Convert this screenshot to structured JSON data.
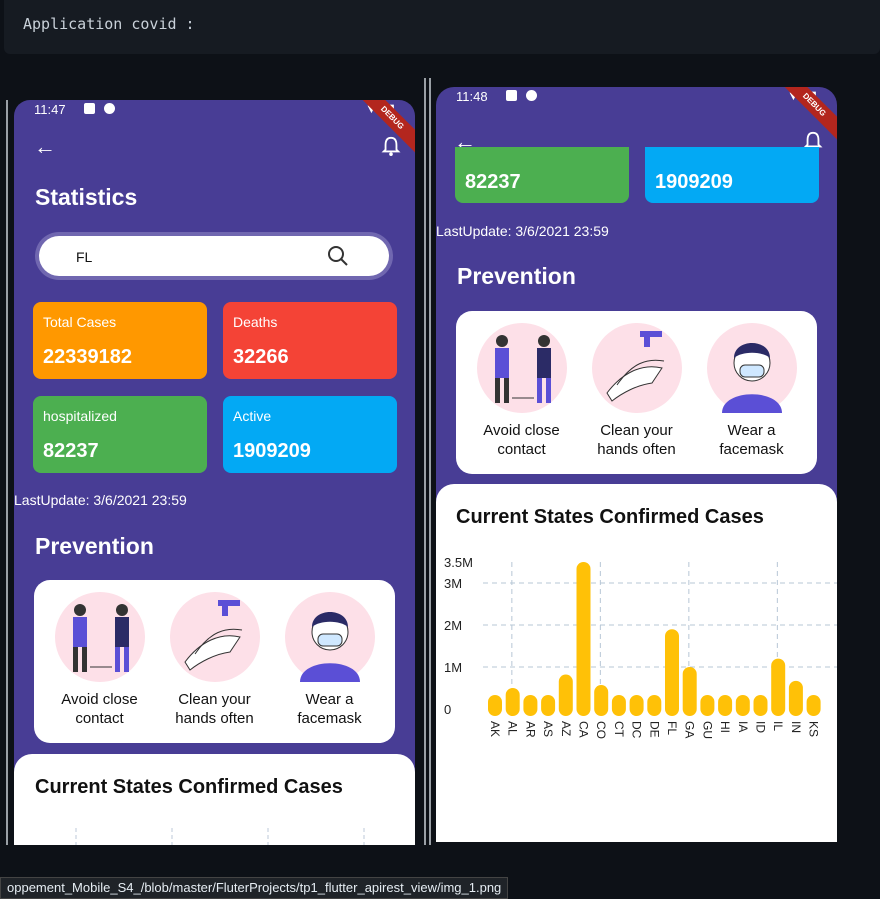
{
  "code_block": {
    "text": "Application covid :"
  },
  "phone1": {
    "time": "11:47",
    "debug": "DEBUG",
    "title": "Statistics",
    "search_value": "FL",
    "cards": [
      {
        "label": "Total Cases",
        "value": "22339182",
        "color": "#ff9800"
      },
      {
        "label": "Deaths",
        "value": "32266",
        "color": "#f44336"
      },
      {
        "label": "hospitalized",
        "value": "82237",
        "color": "#4caf50"
      },
      {
        "label": "Active",
        "value": "1909209",
        "color": "#03a9f4"
      }
    ],
    "last_update": "LastUpdate: 3/6/2021 23:59",
    "prevention_title": "Prevention",
    "prevention": [
      {
        "line1": "Avoid close",
        "line2": "contact",
        "icon": "avoid-contact-icon"
      },
      {
        "line1": "Clean your",
        "line2": "hands often",
        "icon": "wash-hands-icon"
      },
      {
        "line1": "Wear a",
        "line2": "facemask",
        "icon": "facemask-icon"
      }
    ],
    "chart_title": "Current States Confirmed Cases"
  },
  "phone2": {
    "time": "11:48",
    "debug": "DEBUG",
    "card_values": [
      "82237",
      "1909209"
    ],
    "last_update": "LastUpdate: 3/6/2021 23:59",
    "prevention_title": "Prevention",
    "prevention": [
      {
        "line1": "Avoid close",
        "line2": "contact"
      },
      {
        "line1": "Clean your",
        "line2": "hands often"
      },
      {
        "line1": "Wear a",
        "line2": "facemask"
      }
    ],
    "chart_title": "Current States Confirmed Cases"
  },
  "chart_data": {
    "type": "bar",
    "title": "Current States Confirmed Cases",
    "categories": [
      "AK",
      "AL",
      "AR",
      "AS",
      "AZ",
      "CA",
      "CO",
      "CT",
      "DC",
      "DE",
      "FL",
      "GA",
      "GU",
      "HI",
      "IA",
      "ID",
      "IL",
      "IN",
      "KS"
    ],
    "values": [
      60000,
      500000,
      320000,
      0,
      820000,
      3500000,
      570000,
      280000,
      300000,
      85000,
      1900000,
      1000000,
      7000,
      28000,
      330000,
      170000,
      1200000,
      670000,
      300000
    ],
    "yticks": [
      "0",
      "1M",
      "2M",
      "3M",
      "3.5M"
    ],
    "ylim": [
      0,
      3500000
    ],
    "bar_color": "#ffc107",
    "grid": true
  },
  "tooltip": "oppement_Mobile_S4_/blob/master/FluterProjects/tp1_flutter_apirest_view/img_1.png"
}
